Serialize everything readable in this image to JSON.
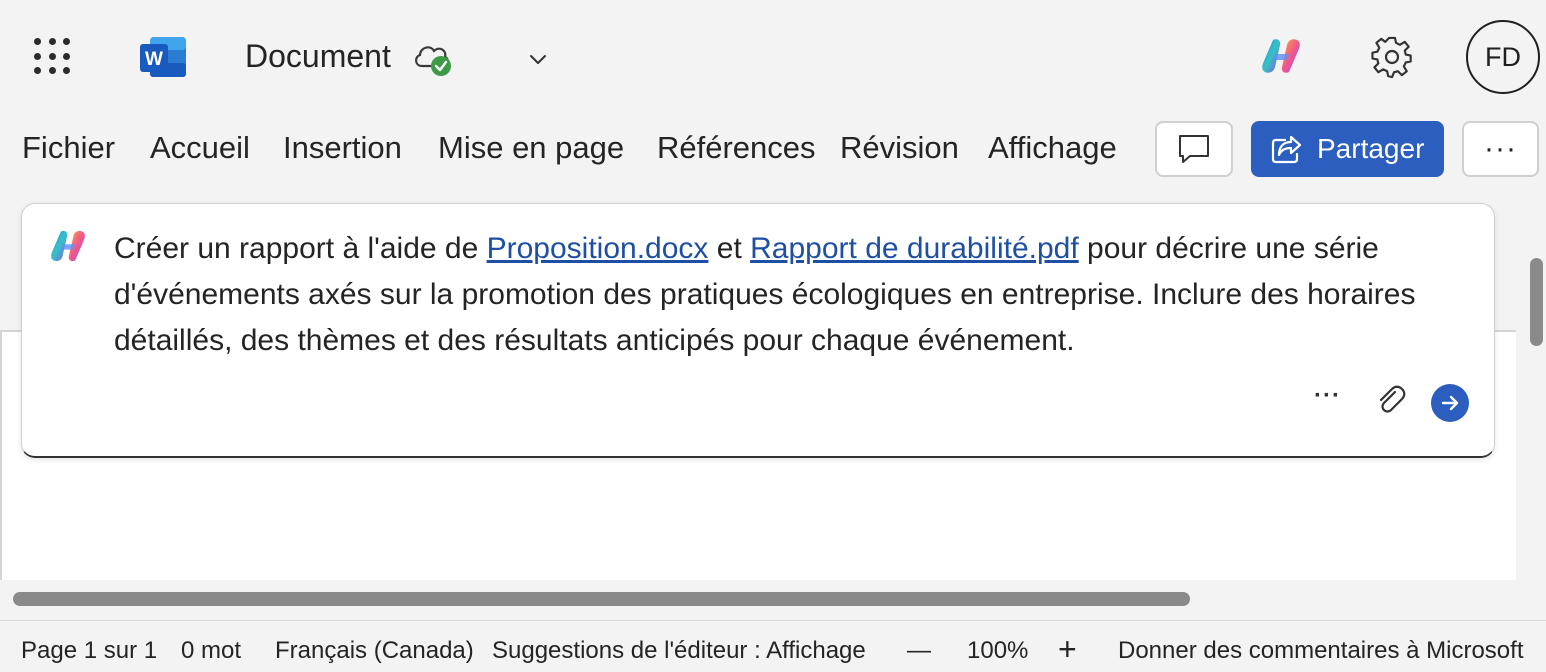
{
  "app": {
    "document_title": "Document",
    "user_initials": "FD",
    "accent_color": "#2b5ebf"
  },
  "ribbon": {
    "tabs": [
      "Fichier",
      "Accueil",
      "Insertion",
      "Mise en page",
      "Références",
      "Révision",
      "Affichage"
    ],
    "share_label": "Partager",
    "more_label": "···"
  },
  "prompt": {
    "text_before": "Créer un rapport à l'aide de ",
    "link1": "Proposition.docx",
    "text_mid": " et ",
    "link2": "Rapport de durabilité.pdf",
    "text_after": " pour décrire une série d'événements axés sur la promotion des pratiques écologiques en entreprise. Inclure des horaires détaillés, des thèmes et des résultats anticipés pour chaque événement.",
    "more_label": "···"
  },
  "status": {
    "page": "Page 1 sur 1",
    "words": "0 mot",
    "language": "Français (Canada)",
    "editor": "Suggestions de l'éditeur : Affichage",
    "zoom_out": "—",
    "zoom": "100%",
    "zoom_in": "+",
    "feedback": "Donner des commentaires à Microsoft"
  },
  "icons": [
    "app-launcher-icon",
    "word-logo-icon",
    "cloud-saved-icon",
    "chevron-down-icon",
    "copilot-icon",
    "gear-icon",
    "comment-icon",
    "share-icon",
    "more-icon",
    "paperclip-icon",
    "send-arrow-icon"
  ]
}
